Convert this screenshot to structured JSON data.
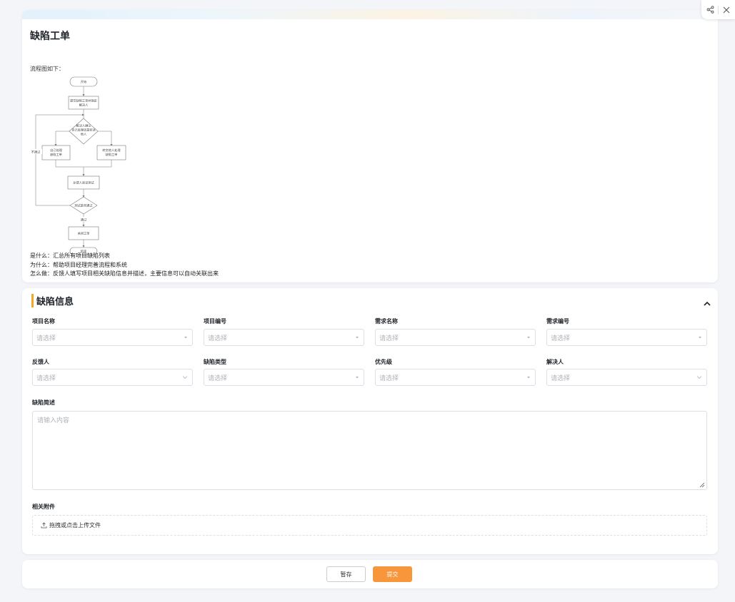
{
  "intro": {
    "title": "缺陷工单",
    "flow_label": "流程图如下：",
    "flowchart": {
      "start": "开始",
      "step1": [
        "提交缺陷工单并指定",
        "解决人"
      ],
      "decision1": [
        "解决人确认",
        "自己处理还是转派",
        "他人"
      ],
      "left_box": [
        "自己处理",
        "缺陷工单"
      ],
      "right_box": [
        "转交他人处理",
        "缺陷工单"
      ],
      "reject": "不通过",
      "verify": "反馈人验证测试",
      "decision2": "测试是否通过",
      "pass": "通过",
      "close": "关闭工单",
      "end": "结束"
    },
    "lines": [
      "是什么：汇总所有项目缺陷列表",
      "为什么：帮助项目经理完善流程和系统",
      "怎么做：反馈人填写项目相关缺陷信息并描述，主要信息可以自动关联出来"
    ]
  },
  "info": {
    "section_title": "缺陷信息",
    "fields": {
      "project_name": {
        "label": "项目名称",
        "placeholder": "请选择"
      },
      "project_no": {
        "label": "项目编号",
        "placeholder": "请选择"
      },
      "req_name": {
        "label": "需求名称",
        "placeholder": "请选择"
      },
      "req_no": {
        "label": "需求编号",
        "placeholder": "请选择"
      },
      "reporter": {
        "label": "反馈人",
        "placeholder": "请选择"
      },
      "defect_type": {
        "label": "缺陷类型",
        "placeholder": "请选择"
      },
      "priority": {
        "label": "优先级",
        "placeholder": "请选择"
      },
      "resolver": {
        "label": "解决人",
        "placeholder": "请选择"
      }
    },
    "description": {
      "label": "缺陷简述",
      "placeholder": "请输入内容"
    },
    "attachment": {
      "label": "相关附件",
      "upload_text": "拖拽或点击上传文件"
    }
  },
  "footer": {
    "save_label": "暂存",
    "submit_label": "提交"
  },
  "colors": {
    "accent": "#f5a623",
    "submit": "#f7963b"
  }
}
